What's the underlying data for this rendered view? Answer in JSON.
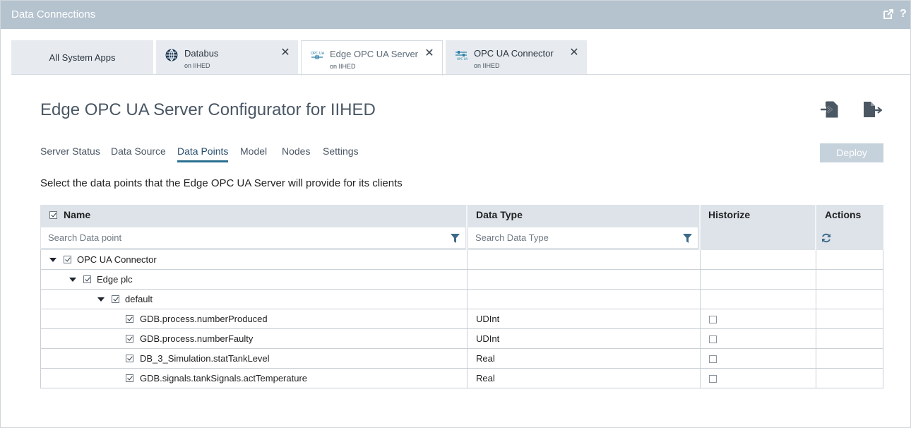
{
  "window": {
    "title": "Data Connections",
    "icons": [
      "external-link-icon",
      "help-icon"
    ]
  },
  "tabs": [
    {
      "title": "All System Apps",
      "subtitle": ""
    },
    {
      "title": "Databus",
      "subtitle": "on IIHED",
      "icon": "globe-network-icon"
    },
    {
      "title": "Edge OPC UA Server",
      "subtitle": "on IIHED",
      "icon": "opcua-server-icon"
    },
    {
      "title": "OPC UA Connector",
      "subtitle": "on IIHED",
      "icon": "opcua-connector-icon"
    }
  ],
  "page": {
    "title": "Edge OPC UA Server Configurator for IIHED",
    "header_icons": [
      "import-icon",
      "export-icon"
    ],
    "nav": [
      "Server Status",
      "Data Source",
      "Data Points",
      "Model",
      "Nodes",
      "Settings"
    ],
    "active_nav": "Data Points",
    "deploy_label": "Deploy",
    "description": "Select the data points that the Edge OPC UA Server will provide for its clients"
  },
  "table": {
    "columns": {
      "name": "Name",
      "data_type": "Data Type",
      "historize": "Historize",
      "actions": "Actions"
    },
    "search_name_placeholder": "Search Data point",
    "search_type_placeholder": "Search Data Type",
    "refresh_icon": "refresh-icon",
    "rows": [
      {
        "name": "OPC UA Connector",
        "type": "",
        "level": 0,
        "expandable": true,
        "checked": true,
        "historize": false
      },
      {
        "name": "Edge plc",
        "type": "",
        "level": 1,
        "expandable": true,
        "checked": true,
        "historize": false
      },
      {
        "name": "default",
        "type": "",
        "level": 2,
        "expandable": true,
        "checked": true,
        "historize": false
      },
      {
        "name": "GDB.process.numberProduced",
        "type": "UDInt",
        "level": 3,
        "expandable": false,
        "checked": true,
        "historize": false
      },
      {
        "name": "GDB.process.numberFaulty",
        "type": "UDInt",
        "level": 3,
        "expandable": false,
        "checked": true,
        "historize": false
      },
      {
        "name": "DB_3_Simulation.statTankLevel",
        "type": "Real",
        "level": 3,
        "expandable": false,
        "checked": true,
        "historize": false
      },
      {
        "name": "GDB.signals.tankSignals.actTemperature",
        "type": "Real",
        "level": 3,
        "expandable": false,
        "checked": true,
        "historize": false
      }
    ]
  },
  "colors": {
    "titlebar": "#b5c3cf",
    "table_header": "#dde3e9",
    "active_tab_underline": "#2a6f8f",
    "deploy_disabled": "#c5d2dc"
  }
}
